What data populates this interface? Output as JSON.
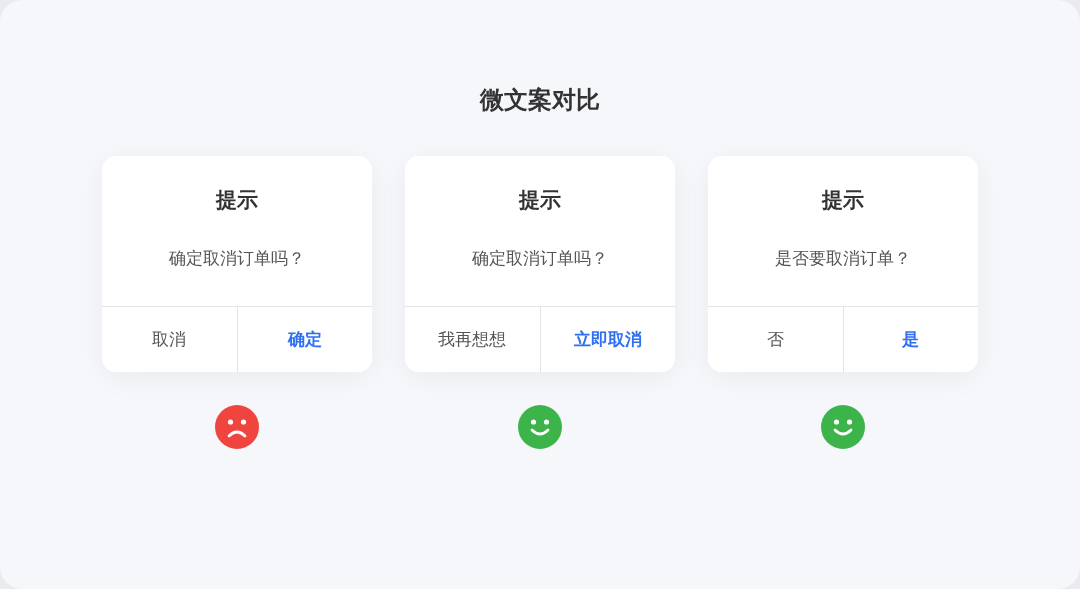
{
  "title": "微文案对比",
  "dialogs": [
    {
      "title": "提示",
      "message": "确定取消订单吗？",
      "buttons": [
        {
          "label": "取消",
          "primary": false
        },
        {
          "label": "确定",
          "primary": true
        }
      ],
      "face": {
        "kind": "sad",
        "color": "#f0453f"
      }
    },
    {
      "title": "提示",
      "message": "确定取消订单吗？",
      "buttons": [
        {
          "label": "我再想想",
          "primary": false
        },
        {
          "label": "立即取消",
          "primary": true
        }
      ],
      "face": {
        "kind": "happy",
        "color": "#3cb44a"
      }
    },
    {
      "title": "提示",
      "message": "是否要取消订单？",
      "buttons": [
        {
          "label": "否",
          "primary": false
        },
        {
          "label": "是",
          "primary": true
        }
      ],
      "face": {
        "kind": "happy",
        "color": "#3cb44a"
      }
    }
  ]
}
